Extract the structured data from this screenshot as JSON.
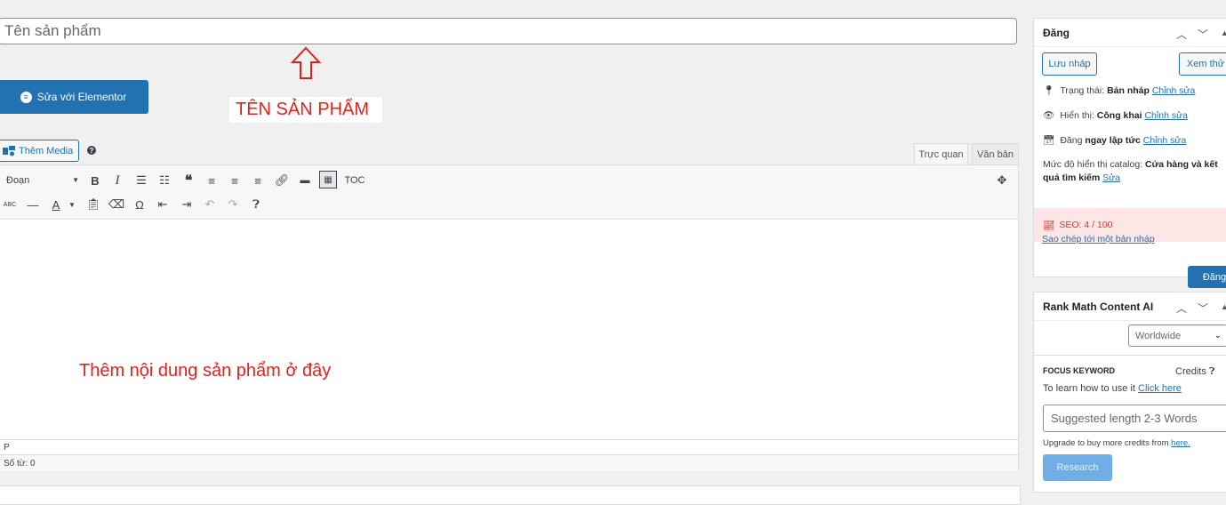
{
  "title_field": {
    "placeholder": "Tên sản phẩm"
  },
  "annotations": {
    "title_hint": "TÊN SẢN PHẨM",
    "content_hint": "Thêm nội dung sản phẩm ở đây",
    "color": "#e0221b"
  },
  "elementor": {
    "label": "Sửa với Elementor",
    "icon": "elementor-icon"
  },
  "media": {
    "label": "Thêm Media"
  },
  "editor_tabs": {
    "visual": "Trực quan",
    "text": "Văn bản",
    "active": "visual"
  },
  "toolbar": {
    "format_select": "Đoạn",
    "toc_label": "TOC",
    "row1_icons": [
      "bold-icon",
      "italic-icon",
      "bullet-list-icon",
      "numbered-list-icon",
      "blockquote-icon",
      "align-left-icon",
      "align-center-icon",
      "align-right-icon",
      "link-icon",
      "read-more-icon",
      "toolbar-toggle-icon"
    ],
    "row2_icons": [
      "strikethrough-icon",
      "horizontal-line-icon",
      "text-color-icon",
      "paste-text-icon",
      "clear-formatting-icon",
      "special-character-icon",
      "outdent-icon",
      "indent-icon",
      "undo-icon",
      "redo-icon",
      "help-icon"
    ]
  },
  "editor_status": {
    "path": "P",
    "word_count": "Số từ: 0"
  },
  "publish_box": {
    "title": "Đăng",
    "save_draft": "Lưu nháp",
    "preview": "Xem thử",
    "status_label": "Trạng thái: ",
    "status_value": "Bản nháp",
    "visibility_label": "Hiển thị: ",
    "visibility_value": "Công khai",
    "schedule_label": "Đăng ",
    "schedule_value": "ngay lập tức",
    "edit_link": "Chỉnh sửa",
    "catalog_label": "Mức độ hiển thị catalog: ",
    "catalog_value_1": "Cửa hàng và kết",
    "catalog_value_2": "quả tìm kiếm",
    "catalog_edit": "Sửa",
    "seo_score": "SEO: 4 / 100",
    "copy_draft": "Sao chép tới một bản nháp",
    "publish": "Đăng"
  },
  "rank_math_box": {
    "title": "Rank Math Content AI",
    "country": "Worldwide",
    "focus_keyword_label": "FOCUS KEYWORD",
    "credits_label": "Credits",
    "learn_text": "To learn how to use it ",
    "learn_link": "Click here",
    "keyword_placeholder": "Suggested length 2-3 Words",
    "upgrade_text": "Upgrade to buy more credits from ",
    "upgrade_link": "here.",
    "research_button": "Research"
  },
  "colors": {
    "accent": "#2271b1",
    "seo_bad": "#d63638",
    "seo_bg": "#fde6e6"
  }
}
